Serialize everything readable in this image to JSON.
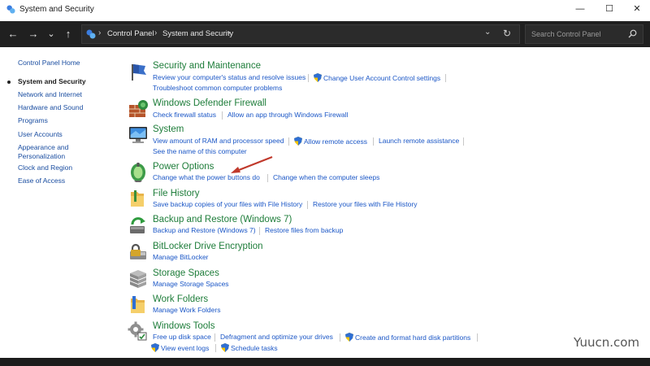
{
  "window": {
    "title": "System and Security"
  },
  "window_controls": {
    "minimize": "—",
    "maximize": "☐",
    "close": "✕"
  },
  "nav": {
    "back": "←",
    "forward": "→",
    "recent": "⌄",
    "up": "↑"
  },
  "breadcrumb": [
    "Control Panel",
    "System and Security"
  ],
  "search": {
    "placeholder": "Search Control Panel"
  },
  "sidebar": {
    "home": "Control Panel Home",
    "items": [
      "System and Security",
      "Network and Internet",
      "Hardware and Sound",
      "Programs",
      "User Accounts",
      "Appearance and Personalization",
      "Clock and Region",
      "Ease of Access"
    ],
    "active_index": 0
  },
  "categories": [
    {
      "title": "Security and Maintenance",
      "tasks": [
        "Review your computer's status and resolve issues",
        "Change User Account Control settings",
        "Troubleshoot common computer problems"
      ]
    },
    {
      "title": "Windows Defender Firewall",
      "tasks": [
        "Check firewall status",
        "Allow an app through Windows Firewall"
      ]
    },
    {
      "title": "System",
      "tasks": [
        "View amount of RAM and processor speed",
        "Allow remote access",
        "Launch remote assistance",
        "See the name of this computer"
      ]
    },
    {
      "title": "Power Options",
      "tasks": [
        "Change what the power buttons do",
        "Change when the computer sleeps"
      ]
    },
    {
      "title": "File History",
      "tasks": [
        "Save backup copies of your files with File History",
        "Restore your files with File History"
      ]
    },
    {
      "title": "Backup and Restore (Windows 7)",
      "tasks": [
        "Backup and Restore (Windows 7)",
        "Restore files from backup"
      ]
    },
    {
      "title": "BitLocker Drive Encryption",
      "tasks": [
        "Manage BitLocker"
      ]
    },
    {
      "title": "Storage Spaces",
      "tasks": [
        "Manage Storage Spaces"
      ]
    },
    {
      "title": "Work Folders",
      "tasks": [
        "Manage Work Folders"
      ]
    },
    {
      "title": "Windows Tools",
      "tasks": [
        "Free up disk space",
        "Defragment and optimize your drives",
        "Create and format hard disk partitions",
        "View event logs",
        "Schedule tasks"
      ]
    }
  ],
  "watermark": "Yuucn.com",
  "colors": {
    "title_green": "#1e7d3a",
    "link_blue": "#1a56c6",
    "toolbar": "#202020",
    "annotation_arrow": "#c0392b"
  }
}
